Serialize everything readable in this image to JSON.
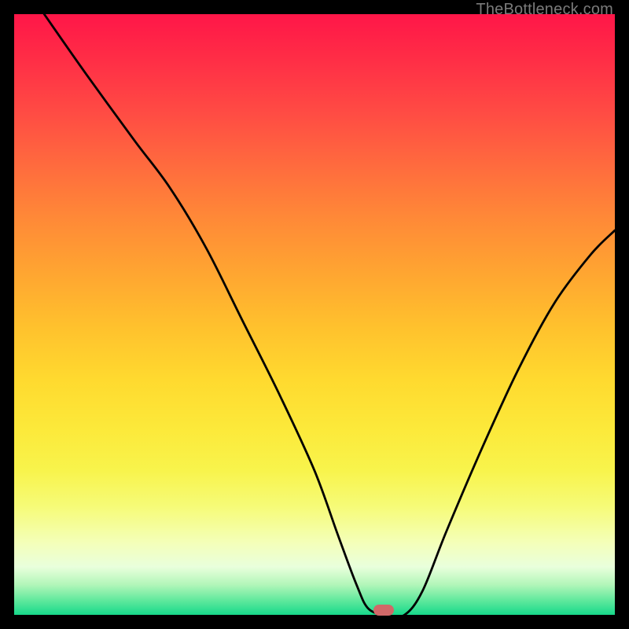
{
  "watermark": {
    "text": "TheBottleneck.com"
  },
  "marker": {
    "color": "#d16868",
    "x_frac": 0.615,
    "y_frac": 0.992
  },
  "chart_data": {
    "type": "line",
    "title": "",
    "xlabel": "",
    "ylabel": "",
    "xlim": [
      0,
      100
    ],
    "ylim": [
      0,
      100
    ],
    "grid": false,
    "legend": false,
    "series": [
      {
        "name": "bottleneck-curve",
        "x": [
          5,
          12,
          20,
          26,
          32,
          38,
          44,
          50,
          54,
          57,
          59,
          62,
          65,
          68,
          72,
          78,
          84,
          90,
          96,
          100
        ],
        "y": [
          100,
          90,
          79,
          71,
          61,
          49,
          37,
          24,
          13,
          5,
          1,
          0,
          0,
          4,
          14,
          28,
          41,
          52,
          60,
          64
        ]
      }
    ],
    "annotations": [
      {
        "type": "marker",
        "shape": "pill",
        "x": 61.5,
        "y": 0.8,
        "color": "#d16868"
      }
    ],
    "background": {
      "gradient": "vertical",
      "stops": [
        {
          "offset": 0.0,
          "color": "#ff1648"
        },
        {
          "offset": 0.25,
          "color": "#ff6a3e"
        },
        {
          "offset": 0.52,
          "color": "#ffc12d"
        },
        {
          "offset": 0.76,
          "color": "#f8f44c"
        },
        {
          "offset": 0.92,
          "color": "#e9ffdc"
        },
        {
          "offset": 1.0,
          "color": "#17d98b"
        }
      ]
    }
  }
}
